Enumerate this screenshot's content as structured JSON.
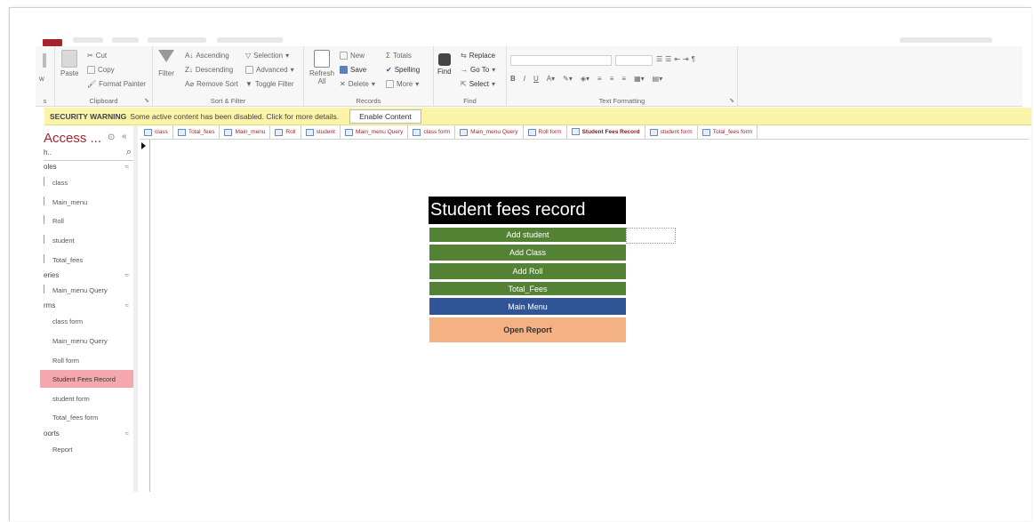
{
  "ribbon": {
    "clipboard": {
      "cut": "Cut",
      "copy": "Copy",
      "paste": "Paste",
      "format_painter": "Format Painter",
      "label": "Clipboard"
    },
    "sort_filter": {
      "filter": "Filter",
      "ascending": "Ascending",
      "descending": "Descending",
      "remove_sort": "Remove Sort",
      "selection": "Selection",
      "advanced": "Advanced",
      "toggle_filter": "Toggle Filter",
      "label": "Sort & Filter"
    },
    "records": {
      "refresh": "Refresh",
      "refresh_all": "All",
      "new": "New",
      "save": "Save",
      "delete": "Delete",
      "totals": "Totals",
      "spelling": "Spelling",
      "more": "More",
      "label": "Records"
    },
    "find": {
      "find": "Find",
      "replace": "Replace",
      "goto": "Go To",
      "select": "Select",
      "label": "Find"
    },
    "text_formatting": {
      "label": "Text Formatting"
    },
    "views_label": "s",
    "view_btn": "w"
  },
  "security": {
    "title": "SECURITY WARNING",
    "message": "Some active content has been disabled. Click for more details.",
    "enable_label": "Enable Content"
  },
  "nav": {
    "title": "Access ...",
    "search_text": "h..",
    "sections": [
      {
        "label": "oles",
        "items": [
          "class",
          "Main_menu",
          "Roll",
          "student",
          "Total_fees"
        ]
      },
      {
        "label": "eries",
        "items": [
          "Main_menu Query"
        ]
      },
      {
        "label": "rms",
        "items": [
          "class form",
          "Main_menu Query",
          "Roll form",
          "Student Fees Record",
          "student form",
          "Total_fees form"
        ]
      },
      {
        "label": "oorts",
        "items": [
          "Report"
        ]
      }
    ]
  },
  "doc_tabs": [
    "class",
    "Total_fees",
    "Main_menu",
    "Roll",
    "student",
    "Main_menu Query",
    "class form",
    "Main_menu Query",
    "Roll form",
    "Student Fees Record",
    "student form",
    "Total_fees form"
  ],
  "active_tab": "Student Fees Record",
  "form": {
    "title": "Student fees record",
    "buttons": [
      "Add student",
      "Add Class",
      "Add Roll",
      "Total_Fees",
      "Main Menu",
      "Open Report"
    ]
  },
  "colors": {
    "accent": "#a4262c",
    "green": "#548235",
    "blue": "#2f5597",
    "orange": "#f4b183",
    "warning_bar": "#fbf3a7",
    "selected_nav": "#f4a8ad"
  }
}
